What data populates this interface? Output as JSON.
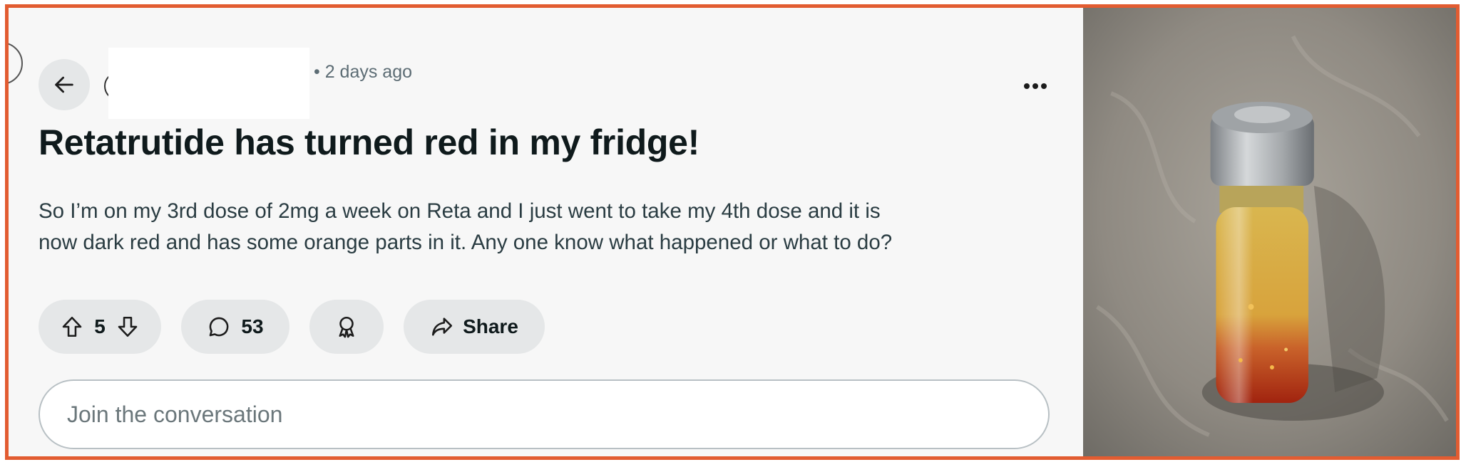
{
  "post": {
    "meta_time": "• 2 days ago",
    "title": "Retatrutide has turned red in my fridge!",
    "body_lines": [
      "So I’m on my 3rd dose of 2mg a week on Reta and I just went to take my 4th dose and it is",
      "now dark red and has some orange parts in it. Any one know what happened or what to do?"
    ]
  },
  "actions": {
    "upvote_count": "5",
    "comment_count": "53",
    "share_label": "Share"
  },
  "reply": {
    "placeholder": "Join the conversation"
  },
  "icons": {
    "back": "arrow-left-icon",
    "more": "more-horizontal-icon",
    "upvote": "arrow-up-icon",
    "downvote": "arrow-down-icon",
    "comment": "speech-bubble-icon",
    "award": "award-ribbon-icon",
    "share": "share-arrow-icon"
  },
  "colors": {
    "frame_border": "#e25c31",
    "post_background": "#f7f7f7",
    "pill_background": "#e5e7e8",
    "title_text": "#0f1a1c",
    "meta_text": "#5c6c74"
  }
}
